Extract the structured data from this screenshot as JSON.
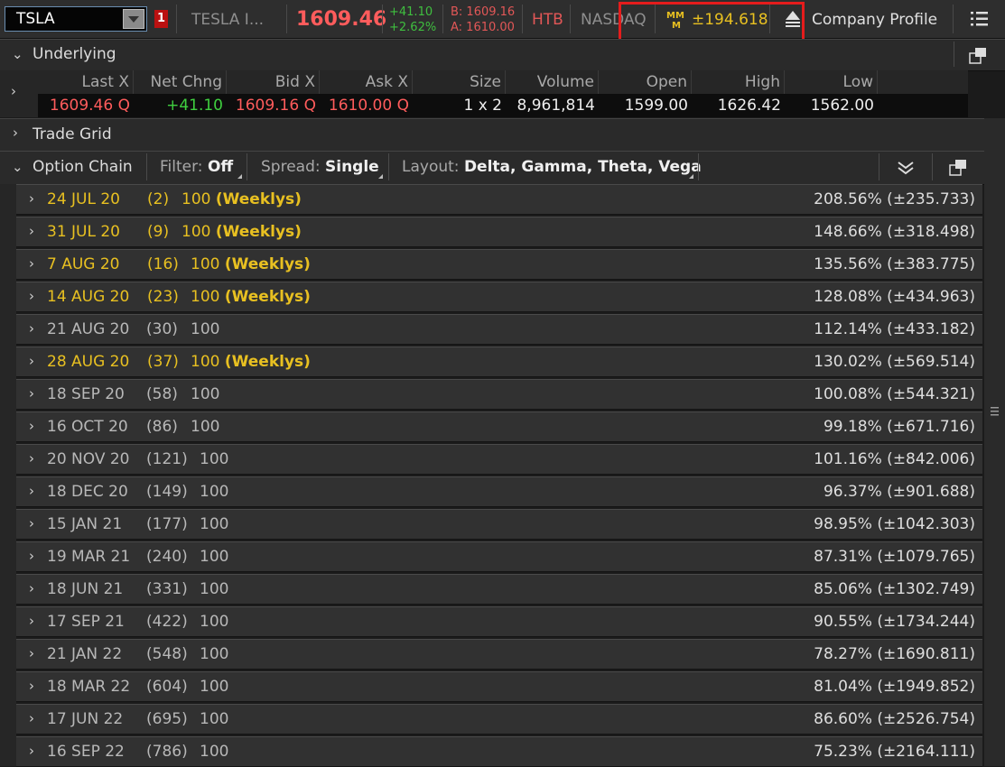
{
  "topbar": {
    "symbol": "TSLA",
    "alert_count": "1",
    "company_short": "TESLA I...",
    "last_price": "1609.46",
    "net_change": "+41.10",
    "pct_change": "+2.62%",
    "bid_line": "B: 1609.16",
    "ask_line": "A: 1610.00",
    "htb": "HTB",
    "exchange": "NASDAQ",
    "market_maker_move": "±194.618",
    "company_profile": "Company Profile"
  },
  "underlying": {
    "title": "Underlying",
    "columns": [
      "Last X",
      "Net Chng",
      "Bid X",
      "Ask X",
      "Size",
      "Volume",
      "Open",
      "High",
      "Low"
    ],
    "values": {
      "last": "1609.46",
      "last_ex": "Q",
      "net_chng": "+41.10",
      "bid": "1609.16",
      "bid_ex": "Q",
      "ask": "1610.00",
      "ask_ex": "Q",
      "size": "1 x 2",
      "volume": "8,961,814",
      "open": "1599.00",
      "high": "1626.42",
      "low": "1562.00"
    }
  },
  "trade_grid": {
    "title": "Trade Grid"
  },
  "option_chain": {
    "title": "Option Chain",
    "filter_label": "Filter:",
    "filter_value": "Off",
    "spread_label": "Spread:",
    "spread_value": "Single",
    "layout_label": "Layout:",
    "layout_value": "Delta, Gamma, Theta, Vega",
    "expirations": [
      {
        "date": "24 JUL 20",
        "days": "(2)",
        "mult": "100",
        "tag": "(Weeklys)",
        "iv": "208.56% (±235.733)",
        "weekly": true
      },
      {
        "date": "31 JUL 20",
        "days": "(9)",
        "mult": "100",
        "tag": "(Weeklys)",
        "iv": "148.66% (±318.498)",
        "weekly": true
      },
      {
        "date": "7 AUG 20",
        "days": "(16)",
        "mult": "100",
        "tag": "(Weeklys)",
        "iv": "135.56% (±383.775)",
        "weekly": true
      },
      {
        "date": "14 AUG 20",
        "days": "(23)",
        "mult": "100",
        "tag": "(Weeklys)",
        "iv": "128.08% (±434.963)",
        "weekly": true
      },
      {
        "date": "21 AUG 20",
        "days": "(30)",
        "mult": "100",
        "tag": "",
        "iv": "112.14% (±433.182)",
        "weekly": false
      },
      {
        "date": "28 AUG 20",
        "days": "(37)",
        "mult": "100",
        "tag": "(Weeklys)",
        "iv": "130.02% (±569.514)",
        "weekly": true
      },
      {
        "date": "18 SEP 20",
        "days": "(58)",
        "mult": "100",
        "tag": "",
        "iv": "100.08% (±544.321)",
        "weekly": false
      },
      {
        "date": "16 OCT 20",
        "days": "(86)",
        "mult": "100",
        "tag": "",
        "iv": "99.18% (±671.716)",
        "weekly": false
      },
      {
        "date": "20 NOV 20",
        "days": "(121)",
        "mult": "100",
        "tag": "",
        "iv": "101.16% (±842.006)",
        "weekly": false
      },
      {
        "date": "18 DEC 20",
        "days": "(149)",
        "mult": "100",
        "tag": "",
        "iv": "96.37% (±901.688)",
        "weekly": false
      },
      {
        "date": "15 JAN 21",
        "days": "(177)",
        "mult": "100",
        "tag": "",
        "iv": "98.95% (±1042.303)",
        "weekly": false
      },
      {
        "date": "19 MAR 21",
        "days": "(240)",
        "mult": "100",
        "tag": "",
        "iv": "87.31% (±1079.765)",
        "weekly": false
      },
      {
        "date": "18 JUN 21",
        "days": "(331)",
        "mult": "100",
        "tag": "",
        "iv": "85.06% (±1302.749)",
        "weekly": false
      },
      {
        "date": "17 SEP 21",
        "days": "(422)",
        "mult": "100",
        "tag": "",
        "iv": "90.55% (±1734.244)",
        "weekly": false
      },
      {
        "date": "21 JAN 22",
        "days": "(548)",
        "mult": "100",
        "tag": "",
        "iv": "78.27% (±1690.811)",
        "weekly": false
      },
      {
        "date": "18 MAR 22",
        "days": "(604)",
        "mult": "100",
        "tag": "",
        "iv": "81.04% (±1949.852)",
        "weekly": false
      },
      {
        "date": "17 JUN 22",
        "days": "(695)",
        "mult": "100",
        "tag": "",
        "iv": "86.60% (±2526.754)",
        "weekly": false
      },
      {
        "date": "16 SEP 22",
        "days": "(786)",
        "mult": "100",
        "tag": "",
        "iv": "75.23% (±2164.111)",
        "weekly": false
      }
    ]
  },
  "icons": [
    "chevron-down-icon",
    "chevron-right-icon",
    "market-maker-move-icon",
    "eject-icon",
    "menu-icon",
    "popout-icon",
    "collapse-all-icon"
  ],
  "colors": {
    "price_up": "#3fcf3f",
    "price_red": "#ff5c5c",
    "weekly_yellow": "#e8c021",
    "highlight": "#e51c1c"
  }
}
